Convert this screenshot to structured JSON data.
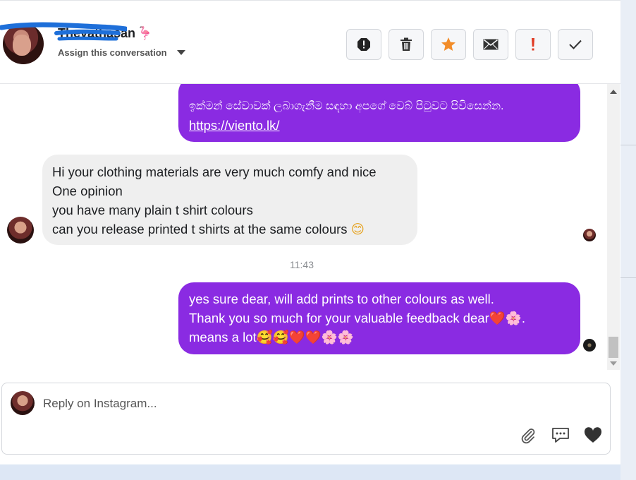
{
  "header": {
    "contact_name": "Thevathasan",
    "name_emoji": "🦩",
    "assign_label": "Assign this conversation"
  },
  "toolbar": {
    "buttons": [
      {
        "icon": "alert-octagon-icon"
      },
      {
        "icon": "trash-icon"
      },
      {
        "icon": "star-icon",
        "color": "#f28c28"
      },
      {
        "icon": "envelope-icon"
      },
      {
        "icon": "exclamation-icon",
        "color": "#e03b24"
      },
      {
        "icon": "checkmark-icon"
      }
    ]
  },
  "messages": [
    {
      "direction": "outgoing",
      "lines": [
        "ඉක්මන් සේවාවක් ලබාගැනීම සඳහා අපගේ වෙබ් පිටුවට පිවිසෙන්න.",
        "https://viento.lk/"
      ]
    },
    {
      "direction": "incoming",
      "lines": [
        "Hi your clothing materials are very much comfy and nice",
        "One opinion",
        "you have many plain t shirt colours",
        "can you release printed t shirts at the same colours"
      ],
      "trailing_emoji": "😊"
    },
    {
      "direction": "outgoing",
      "lines": [
        "yes sure dear, will add prints to other colours as well.",
        "Thank you so much for your valuable feedback dear",
        "means a lot"
      ],
      "line2_emoji": "❤️🌸",
      "line2_tail": ".",
      "line3_emoji": "🥰🥰❤️❤️🌸🌸"
    }
  ],
  "timestamp": "11:43",
  "reply": {
    "placeholder": "Reply on Instagram..."
  },
  "colors": {
    "outgoing_bubble": "#8a2be2",
    "incoming_bubble": "#efefef"
  }
}
